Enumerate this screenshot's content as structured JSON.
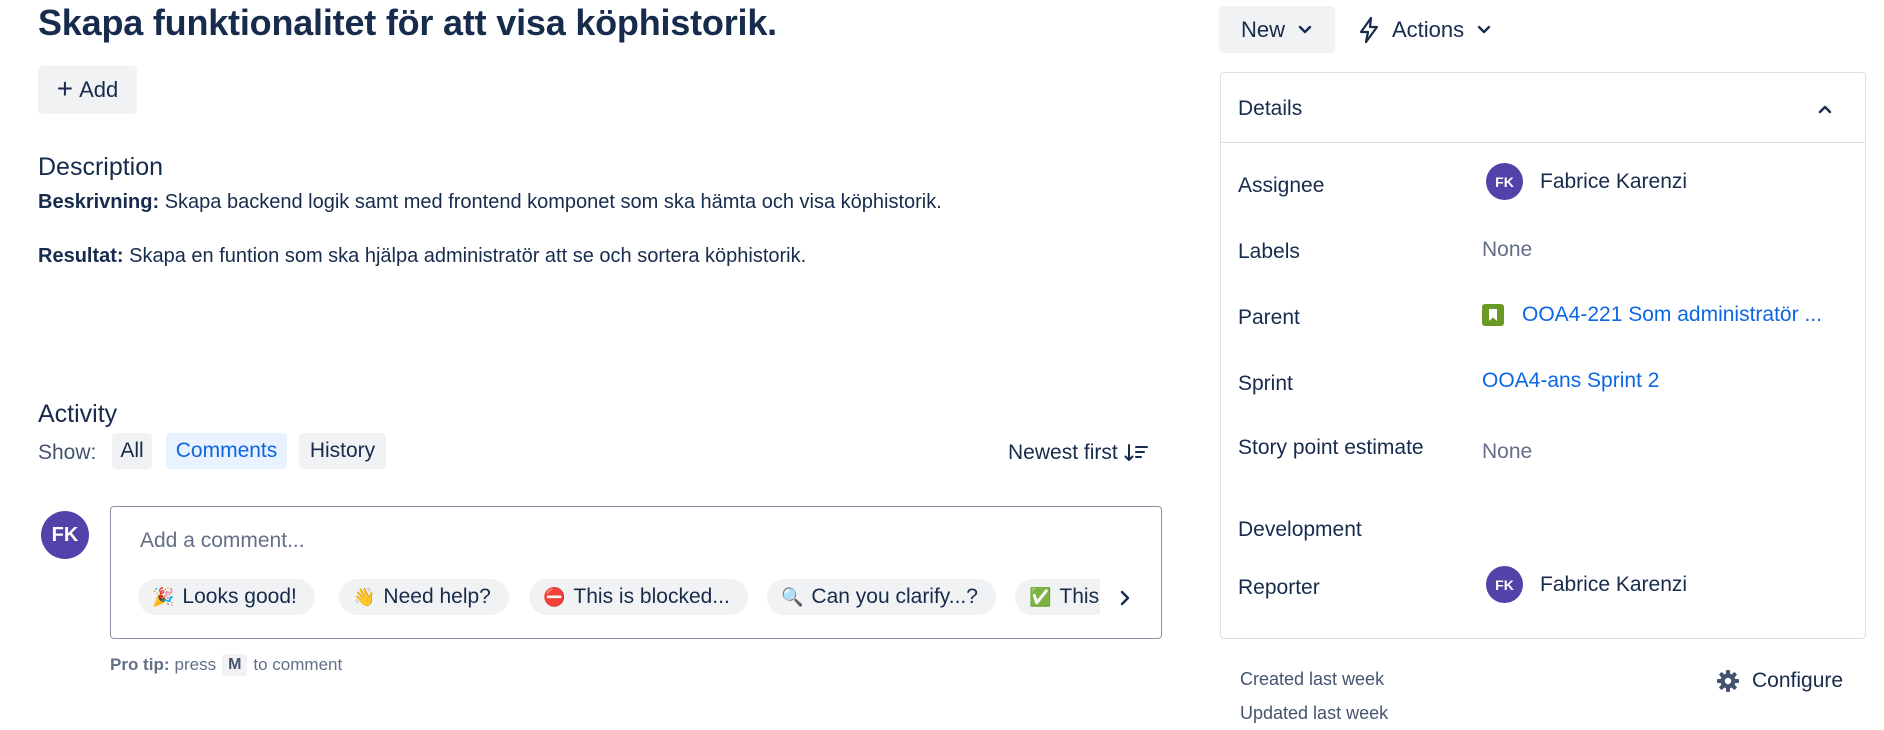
{
  "issue": {
    "title": "Skapa funktionalitet för att visa köphistorik.",
    "add_label": "Add"
  },
  "description": {
    "heading": "Description",
    "line1_bold": "Beskrivning:",
    "line1_text": "Skapa backend logik samt med frontend komponet som ska hämta och visa köphistorik.",
    "line2_bold": "Resultat:",
    "line2_text": "Skapa en funtion som ska hjälpa administratör att se och sortera köphistorik."
  },
  "activity": {
    "heading": "Activity",
    "show_label": "Show:",
    "filters": [
      "All",
      "Comments",
      "History"
    ],
    "active_filter": "Comments",
    "sort_label": "Newest first",
    "user_initials": "FK",
    "comment_placeholder": "Add a comment...",
    "quick_replies": [
      {
        "emoji": "🎉",
        "label": "Looks good!"
      },
      {
        "emoji": "👋",
        "label": "Need help?"
      },
      {
        "emoji": "⛔",
        "label": "This is blocked..."
      },
      {
        "emoji": "🔍",
        "label": "Can you clarify...?"
      },
      {
        "emoji": "✅",
        "label": "This is on track"
      }
    ],
    "pro_tip_bold": "Pro tip:",
    "pro_tip_press": "press",
    "pro_tip_key": "M",
    "pro_tip_suffix": "to comment"
  },
  "header_actions": {
    "status": "New",
    "actions": "Actions"
  },
  "details": {
    "title": "Details",
    "assignee_label": "Assignee",
    "assignee_initials": "FK",
    "assignee_name": "Fabrice Karenzi",
    "labels_label": "Labels",
    "labels_value": "None",
    "parent_label": "Parent",
    "parent_value": "OOA4-221 Som administratör ...",
    "sprint_label": "Sprint",
    "sprint_value": "OOA4-ans Sprint 2",
    "story_points_label": "Story point estimate",
    "story_points_value": "None",
    "development_label": "Development",
    "reporter_label": "Reporter",
    "reporter_initials": "FK",
    "reporter_name": "Fabrice Karenzi"
  },
  "meta": {
    "created": "Created last week",
    "updated": "Updated last week",
    "configure": "Configure"
  },
  "colors": {
    "text": "#172b4d",
    "link": "#0c66e4",
    "avatar": "#5243aa",
    "button_bg": "#f1f2f4",
    "selected_bg": "#e9f2ff",
    "parent_icon": "#6a9a23"
  }
}
